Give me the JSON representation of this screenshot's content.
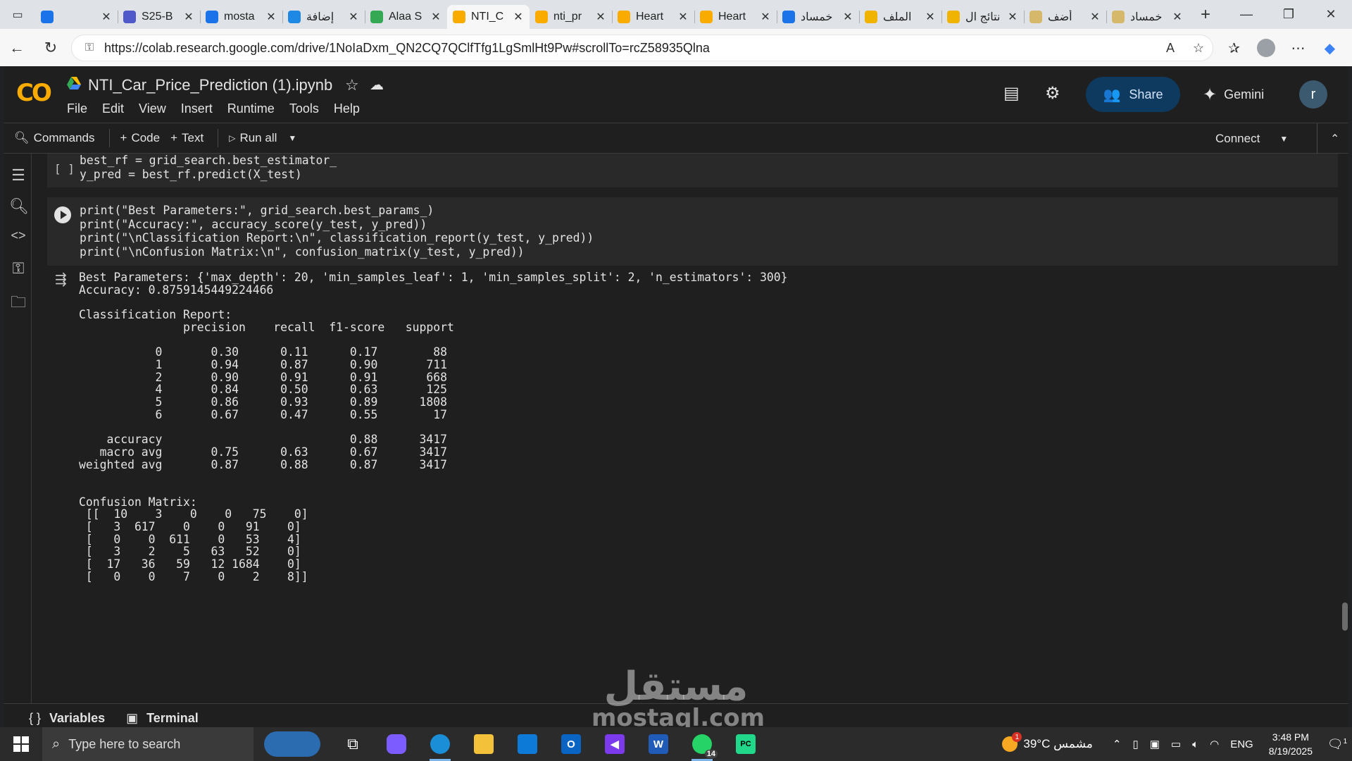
{
  "browser": {
    "tabs": [
      {
        "label": "",
        "fav_color": "#1a73e8",
        "active": false
      },
      {
        "label": "S25-B",
        "fav_color": "#5059c9",
        "active": false
      },
      {
        "label": "mosta",
        "fav_color": "#1a73e8",
        "active": false
      },
      {
        "label": "إضافة",
        "fav_color": "#1e88e5",
        "active": false
      },
      {
        "label": "Alaa S",
        "fav_color": "#34a853",
        "active": false
      },
      {
        "label": "NTI_C",
        "fav_color": "#f9ab00",
        "active": true
      },
      {
        "label": "nti_pr",
        "fav_color": "#f9ab00",
        "active": false
      },
      {
        "label": "Heart",
        "fav_color": "#f9ab00",
        "active": false
      },
      {
        "label": "Heart",
        "fav_color": "#f9ab00",
        "active": false
      },
      {
        "label": "خمساد",
        "fav_color": "#1a73e8",
        "active": false
      },
      {
        "label": "الملف",
        "fav_color": "#f0b400",
        "active": false
      },
      {
        "label": "نتائج ال",
        "fav_color": "#f0b400",
        "active": false
      },
      {
        "label": "أضف",
        "fav_color": "#d6b86a",
        "active": false
      },
      {
        "label": "خمساد",
        "fav_color": "#d6b86a",
        "active": false
      }
    ],
    "close_glyph": "✕",
    "new_tab_glyph": "+",
    "url": "https://colab.research.google.com/drive/1NoIaDxm_QN2CQ7QClfTfg1LgSmlHt9Pw#scrollTo=rcZ58935Qlna"
  },
  "colab": {
    "logo": "CO",
    "title": "NTI_Car_Price_Prediction (1).ipynb",
    "menu": [
      "File",
      "Edit",
      "View",
      "Insert",
      "Runtime",
      "Tools",
      "Help"
    ],
    "share_label": "Share",
    "gemini_label": "Gemini",
    "user_initial": "r",
    "toolbar": {
      "commands": "Commands",
      "code": "Code",
      "text": "Text",
      "run_all": "Run all",
      "connect": "Connect"
    },
    "bottom": {
      "variables": "Variables",
      "terminal": "Terminal"
    }
  },
  "cells": {
    "cell1": {
      "bracket": "[ ]",
      "lines": [
        "best_rf = grid_search.best_estimator_",
        "y_pred = best_rf.predict(X_test)"
      ]
    },
    "cell2": {
      "lines": [
        "print(\"Best Parameters:\", grid_search.best_params_)",
        "print(\"Accuracy:\", accuracy_score(y_test, y_pred))",
        "print(\"\\nClassification Report:\\n\", classification_report(y_test, y_pred))",
        "print(\"\\nConfusion Matrix:\\n\", confusion_matrix(y_test, y_pred))"
      ]
    },
    "output": "Best Parameters: {'max_depth': 20, 'min_samples_leaf': 1, 'min_samples_split': 2, 'n_estimators': 300}\nAccuracy: 0.8759145449224466\n\nClassification Report:\n               precision    recall  f1-score   support\n\n           0       0.30      0.11      0.17        88\n           1       0.94      0.87      0.90       711\n           2       0.90      0.91      0.91       668\n           4       0.84      0.50      0.63       125\n           5       0.86      0.93      0.89      1808\n           6       0.67      0.47      0.55        17\n\n    accuracy                           0.88      3417\n   macro avg       0.75      0.63      0.67      3417\nweighted avg       0.87      0.88      0.87      3417\n\n\nConfusion Matrix:\n [[  10    3    0    0   75    0]\n [   3  617    0    0   91    0]\n [   0    0  611    0   53    4]\n [   3    2    5   63   52    0]\n [  17   36   59   12 1684    0]\n [   0    0    7    0    2    8]]"
  },
  "watermark": {
    "line1": "مستقل",
    "line2": "mostaql.com"
  },
  "taskbar": {
    "search_placeholder": "Type here to search",
    "weather": "39°C  مشمس",
    "weather_badge": "1",
    "lang": "ENG",
    "time": "3:48 PM",
    "date": "8/19/2025",
    "whatsapp_badge": "14",
    "notif_count": "1"
  }
}
